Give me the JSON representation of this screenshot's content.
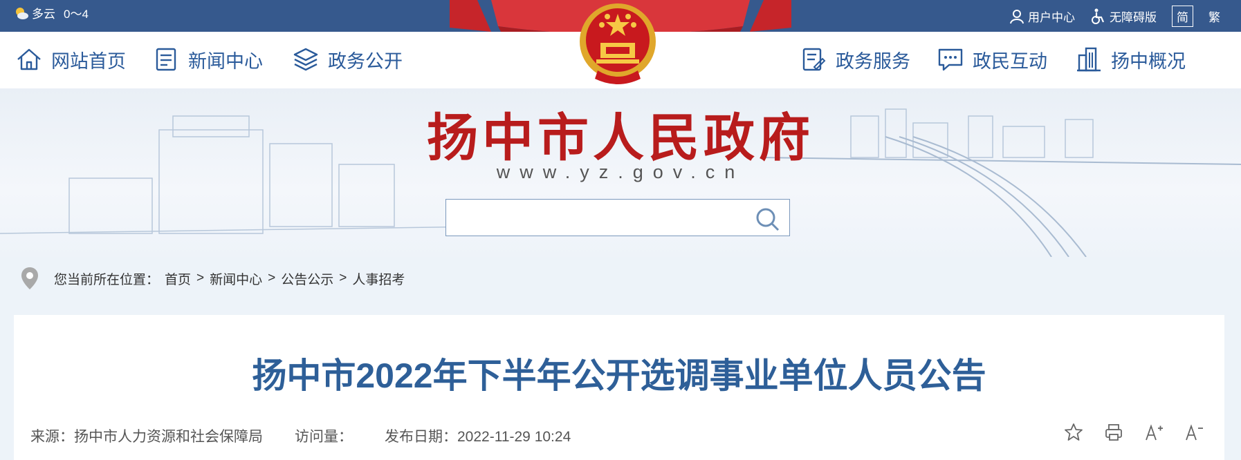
{
  "topbar": {
    "weather": "多云",
    "temp": "0～4",
    "user_center": "用户中心",
    "accessibility": "无障碍版",
    "lang_simplified": "简",
    "lang_traditional": "繁"
  },
  "nav": {
    "left": [
      "网站首页",
      "新闻中心",
      "政务公开"
    ],
    "right": [
      "政务服务",
      "政民互动",
      "扬中概况"
    ]
  },
  "banner": {
    "title": "扬中市人民政府",
    "url": "www.yz.gov.cn",
    "search_placeholder": ""
  },
  "breadcrumb": {
    "prefix": "您当前所在位置：",
    "items": [
      "首页",
      "新闻中心",
      "公告公示",
      "人事招考"
    ]
  },
  "article": {
    "title": "扬中市2022年下半年公开选调事业单位人员公告",
    "source": "来源：扬中市人力资源和社会保障局",
    "views": "访问量：",
    "date": "发布日期：2022-11-29 10:24"
  },
  "colors": {
    "topbar": "#36598d",
    "nav_text": "#2a5a9a",
    "title_red": "#b81c1c",
    "article_title": "#2e5f98"
  }
}
